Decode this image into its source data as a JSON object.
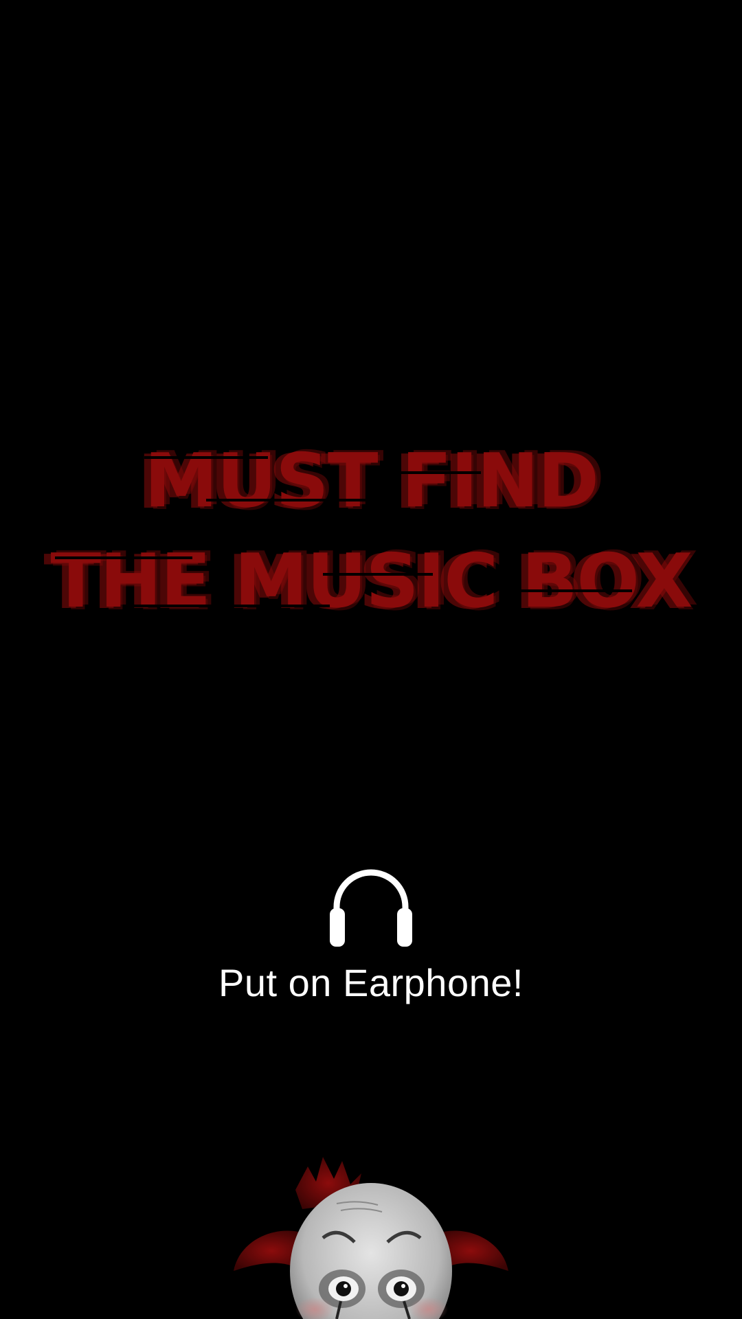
{
  "title": {
    "line1": "MUST FIND",
    "line2": "THE MUSIC BOX"
  },
  "hint": {
    "icon": "headphone-icon",
    "text": "Put on Earphone!"
  },
  "colors": {
    "background": "#000000",
    "title": "#8a0b0b",
    "hint_text": "#ffffff",
    "clown_hair": "#7a0a0a",
    "clown_face": "#d8d8d8"
  },
  "decor": {
    "bottom_figure": "clown-face"
  }
}
